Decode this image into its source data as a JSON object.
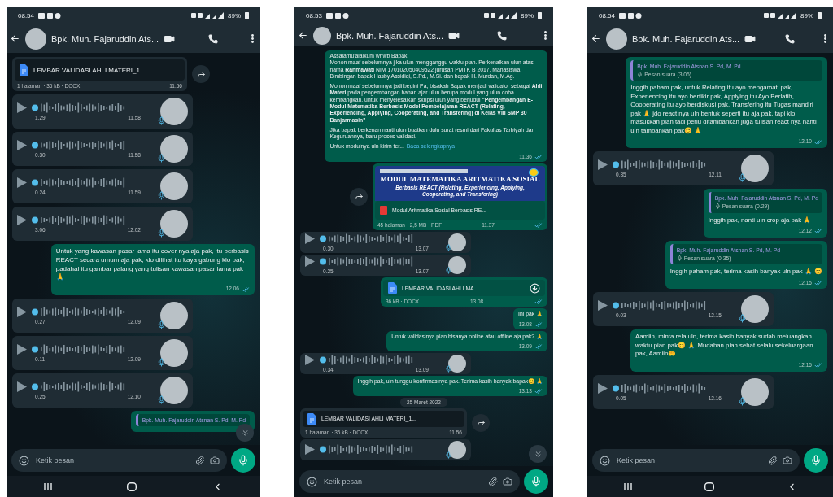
{
  "phones": [
    {
      "status_bar": {
        "time": "08.54",
        "battery": "89%"
      },
      "contact": {
        "name": "Bpk. Muh. Fajaruddin Ats..."
      },
      "nav_bar": true,
      "scroll_down": true,
      "messages": [
        {
          "kind": "document",
          "outgoing": false,
          "name": "LEMBAR VALIDASI AHLI MATERI_1...",
          "details": "1 halaman · 36 kB · DOCX",
          "time": "11.56"
        },
        {
          "kind": "voice",
          "outgoing": false,
          "duration": "1.29",
          "time": "11.58"
        },
        {
          "kind": "voice",
          "outgoing": false,
          "duration": "0.30",
          "time": "11.58"
        },
        {
          "kind": "voice",
          "outgoing": false,
          "duration": "0.24",
          "time": "11.59"
        },
        {
          "kind": "voice",
          "outgoing": false,
          "duration": "3.06",
          "time": "12.02"
        },
        {
          "kind": "text",
          "outgoing": true,
          "text": "Untuk yang kawasan pasar lama itu cover nya aja pak, itu berbasis REACT secara umum aja pak, klo dilihat itu kaya gabung klo pak, padahal itu gambar palang yang tulisan kawasan pasar lama pak 🙏",
          "time": "12.06",
          "read": true
        },
        {
          "kind": "voice",
          "outgoing": false,
          "duration": "0.27",
          "time": "12.09"
        },
        {
          "kind": "voice",
          "outgoing": false,
          "duration": "0.11",
          "time": "12.09"
        },
        {
          "kind": "voice",
          "outgoing": false,
          "duration": "0.25",
          "time": "12.10"
        },
        {
          "kind": "reply",
          "outgoing": true,
          "quote_author": "Bpk. Muh. Fajaruddin Atsnan S. Pd, M. Pd"
        }
      ],
      "input": {
        "placeholder": "Ketik pesan"
      }
    },
    {
      "status_bar": {
        "time": "08.53",
        "battery": "89%"
      },
      "contact": {
        "name": "Bpk. Muh. Fajaruddin Ats..."
      },
      "nav_bar": false,
      "scroll_down": true,
      "messages": [
        {
          "kind": "text",
          "outgoing": true,
          "paragraphs": [
            "Assalamu'alaikum wr.wb Bapak\nMohon maaf sebelumnya jika ulun mengganggu waktu pian. Perkenalkan ulun atas nama **Rahmawati** NIM 170102050409522 jurusan PMTK B 2017, Mahasiswa Bimbingan bapak Hasby Assidiqi, S.Pd., M.Si. dan bapak H. Murdan, M.Ag.",
            "Mohon maaf sebelumnya jadi begini Pa, bisakah Bapak menjadi validator sebagai **Ahli Materi** pada pengembangan bahan ajar ulun berupa modul yang ulun coba kembangkan, untuk menyelesaikan skripsi ulun yang berjudul **\"Pengembangan E-Modul Matematika Berbasis Model Pembelajaran REACT (Relating, Experiencing, Applying, Cooperating, and Transfering) di Kelas VIII SMP 30 Banjarmasin\"**",
            "Jika bapak berkenan nanti ulun buatkan dulu surat resmi dari Fakultas Tarbiyah dan Keguruannya, baru proses validasi.",
            "Untuk modulnya uln kirim ter..."
          ],
          "read_more": "Baca selengkapnya",
          "time": "11.36",
          "read": true
        },
        {
          "kind": "pdf",
          "outgoing": true,
          "cover_title": "MODUL MATEMATIKA ARITMATIKA SOSIAL",
          "cover_subtitle": "Berbasis REACT (Relating, Experiencing, Applying, Cooperating, and Transfering)",
          "name": "Modul Aritmatika Sosial Berbasis RE...",
          "details": "45 halaman · 2,5 MB · PDF",
          "time": "11.37",
          "read": true
        },
        {
          "kind": "voice",
          "outgoing": false,
          "duration": "0.30",
          "time": "13.07"
        },
        {
          "kind": "voice",
          "outgoing": false,
          "duration": "0.25",
          "time": "13.07"
        },
        {
          "kind": "document",
          "outgoing": true,
          "name": "LEMBAR VALIDASI AHLI MA...",
          "details": "36 kB · DOCX",
          "time": "13.08",
          "read": true
        },
        {
          "kind": "text",
          "outgoing": true,
          "text": "Ini pak 🙏",
          "time": "13.08",
          "read": true
        },
        {
          "kind": "text",
          "outgoing": true,
          "text": "Untuk validasinya pian bisanya online atau offline aja pak? 🙏",
          "time": "13.09",
          "read": true
        },
        {
          "kind": "voice",
          "outgoing": false,
          "duration": "0.34",
          "time": "13.09"
        },
        {
          "kind": "text",
          "outgoing": true,
          "text": "Inggih pak, uln tunggu konfirmasinya pak. Terima kasih banyak bapak😊 🙏",
          "time": "13.13",
          "read": true
        },
        {
          "kind": "date",
          "text": "25 Maret 2022"
        },
        {
          "kind": "document",
          "outgoing": false,
          "name": "LEMBAR VALIDASI AHLI MATERI_1...",
          "details": "1 halaman · 36 kB · DOCX",
          "time": "11.56"
        },
        {
          "kind": "voice",
          "outgoing": false
        }
      ],
      "input": {
        "placeholder": "Ketik pesan"
      }
    },
    {
      "status_bar": {
        "time": "08.54",
        "battery": "89%"
      },
      "contact": {
        "name": "Bpk. Muh. Fajaruddin Ats..."
      },
      "nav_bar": true,
      "scroll_down": false,
      "messages": [
        {
          "kind": "reply",
          "outgoing": true,
          "quote_author": "Bpk. Muh. Fajaruddin Atsnan S. Pd, M. Pd",
          "quote": "Pesan suara (3.06)",
          "text": "Inggih paham pak, untuk Relating itu ayo mengamati pak, Experiencing itu ayo berfikir pak, Applying itu Ayo Berlatih, Cooperating itu ayo berdiskusi pak, Transfering itu Tugas mandiri pak 🙏  jdo react nya uln bentuk seperti itu aja pak, tapi klo masukkan pian tadi perlu ditambahkan juga tulisan react nya nanti uln tambahkan pak😊 🙏",
          "time": "12.10",
          "read": true
        },
        {
          "kind": "voice",
          "outgoing": false,
          "duration": "0.35",
          "time": "12.11"
        },
        {
          "kind": "reply",
          "outgoing": true,
          "quote_author": "Bpk. Muh. Fajaruddin Atsnan S. Pd, M. Pd",
          "quote": "Pesan suara (0.29)",
          "text": "Inggih pak, nanti uln crop aja pak 🙏",
          "time": "12.12",
          "read": true
        },
        {
          "kind": "reply",
          "outgoing": true,
          "quote_author": "Bpk. Muh. Fajaruddin Atsnan S. Pd, M. Pd",
          "quote": "Pesan suara (0.35)",
          "text": "Inggih paham pak, terima kasih banyak uln pak 🙏 😊",
          "time": "12.15",
          "read": true
        },
        {
          "kind": "voice",
          "outgoing": false,
          "duration": "0.03",
          "time": "12.15"
        },
        {
          "kind": "text",
          "outgoing": true,
          "text": "Aamiin, minta rela uln, terima kasih banyak sudah meluangkan waktu pian pak😊 🙏  Mudahan pian sehat selalu sekeluargaan pak, Aamiin🤲",
          "time": "12.15",
          "read": true
        },
        {
          "kind": "voice",
          "outgoing": false,
          "duration": "0.05",
          "time": "12.16"
        }
      ],
      "input": {
        "placeholder": "Ketik pesan"
      }
    }
  ]
}
